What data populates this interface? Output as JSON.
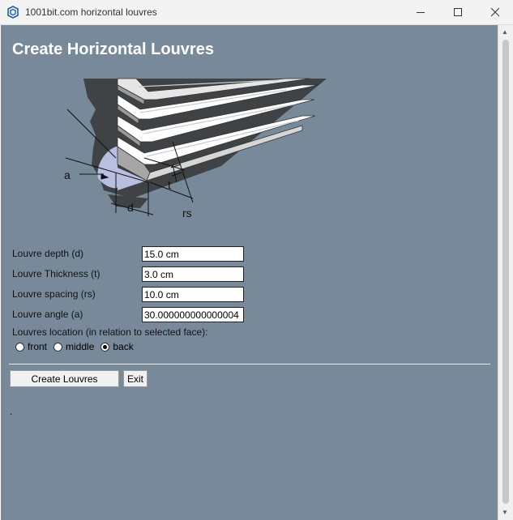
{
  "window": {
    "title": "1001bit.com horizontal louvres"
  },
  "page": {
    "heading": "Create Horizontal Louvres",
    "diagram_labels": {
      "angle": "a",
      "thickness": "t",
      "spacing": "rs",
      "depth": "d"
    }
  },
  "form": {
    "depth": {
      "label": "Louvre depth (d)",
      "value": "15.0 cm"
    },
    "thickness": {
      "label": "Louvre Thickness (t)",
      "value": "3.0 cm"
    },
    "spacing": {
      "label": "Louvre spacing (rs)",
      "value": "10.0 cm"
    },
    "angle": {
      "label": "Louvre angle (a)",
      "value": "30.000000000000004"
    },
    "location_label": "Louvres location (in relation to selected face):",
    "location_options": {
      "front": "front",
      "middle": "middle",
      "back": "back"
    },
    "location_selected": "back"
  },
  "buttons": {
    "create": "Create Louvres",
    "exit": "Exit"
  },
  "status_text": "."
}
